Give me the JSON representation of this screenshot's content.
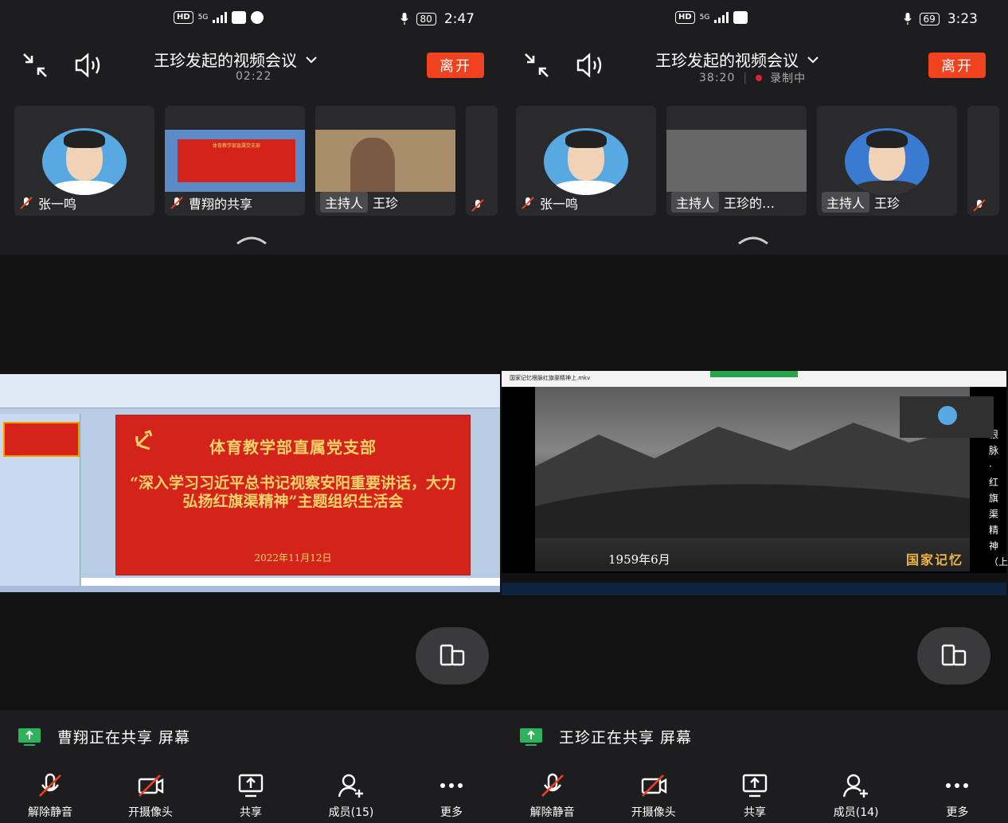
{
  "left": {
    "status": {
      "network": "5G",
      "battery": "80",
      "time": "2:47"
    },
    "meeting": {
      "title": "王珍发起的视频会议",
      "elapsed": "02:22",
      "leave_label": "离开"
    },
    "participants": [
      {
        "name": "张一鸣",
        "host": false
      },
      {
        "name": "曹翔的共享",
        "host": false
      },
      {
        "name": "王珍",
        "host": true,
        "host_label": "主持人"
      }
    ],
    "slide": {
      "org": "体育教学部直属党支部",
      "theme": "“深入学习习近平总书记视察安阳重要讲话，大力弘扬红旗渠精神”主题组织生活会",
      "date": "2022年11月12日"
    },
    "sharing_text": "曹翔正在共享 屏幕",
    "toolbar": [
      "解除静音",
      "开摄像头",
      "共享",
      "成员(15)",
      "更多"
    ]
  },
  "right": {
    "status": {
      "network": "5G",
      "battery": "69",
      "time": "3:23"
    },
    "meeting": {
      "title": "王珍发起的视频会议",
      "elapsed": "38:20",
      "recording": "录制中",
      "leave_label": "离开"
    },
    "participants": [
      {
        "name": "张一鸣",
        "host": false
      },
      {
        "name": "王珍的…",
        "host": true,
        "host_label": "主持人"
      },
      {
        "name": "王珍",
        "host": true,
        "host_label": "主持人"
      }
    ],
    "video": {
      "file_title": "国家记忆根脉红旗渠精神上.mkv",
      "year_caption": "1959年6月",
      "brand": "国家记忆",
      "side_caption": "根脉·红旗渠精神（上）"
    },
    "sharing_text": "王珍正在共享 屏幕",
    "toolbar": [
      "解除静音",
      "开摄像头",
      "共享",
      "成员(14)",
      "更多"
    ]
  }
}
